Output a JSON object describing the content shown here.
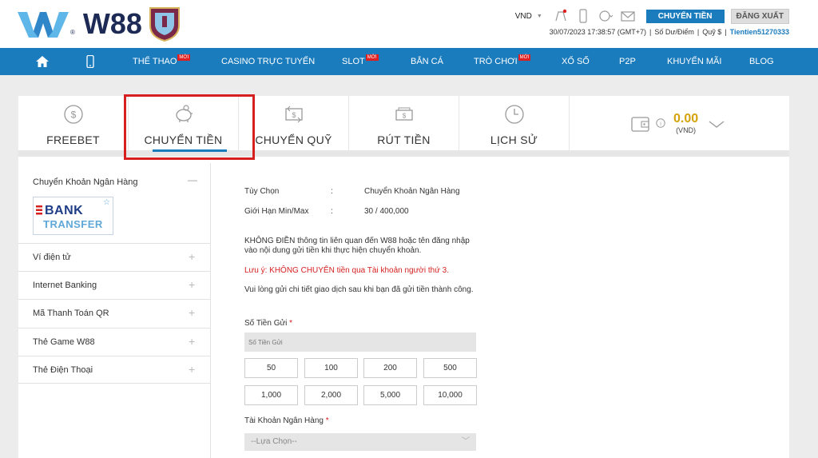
{
  "header": {
    "brand": "W88",
    "brand_dot": "®",
    "currency": "VND",
    "transfer_button": "CHUYỂN TIỀN",
    "logout_button": "ĐĂNG XUẤT",
    "datetime": "30/07/2023 17:38:57 (GMT+7)",
    "separator": "|",
    "balance_label": "Số Dư/Điểm",
    "fund_label": "Quỹ $",
    "username": "Tientien51270333"
  },
  "nav": {
    "badge": "MỚI",
    "items": [
      {
        "label": "THỂ THAO"
      },
      {
        "label": "CASINO TRỰC TUYẾN"
      },
      {
        "label": "SLOT"
      },
      {
        "label": "BẮN CÁ"
      },
      {
        "label": "TRÒ CHƠI"
      },
      {
        "label": "XỔ SỐ"
      },
      {
        "label": "P2P"
      },
      {
        "label": "KHUYẾN MÃI"
      },
      {
        "label": "BLOG"
      }
    ]
  },
  "tabs": [
    {
      "label": "FREEBET"
    },
    {
      "label": "CHUYỂN TIỀN"
    },
    {
      "label": "CHUYỂN QUỸ"
    },
    {
      "label": "RÚT TIỀN"
    },
    {
      "label": "LỊCH SỬ"
    }
  ],
  "wallet": {
    "amount": "0.00",
    "currency": "(VND)"
  },
  "sidebar": {
    "first": "Chuyển Khoản Ngân Hàng",
    "bank_logo_line1": "BANK",
    "bank_logo_line2": "TRANSFER",
    "items": [
      {
        "label": "Ví điện tử"
      },
      {
        "label": "Internet Banking"
      },
      {
        "label": "Mã Thanh Toán QR"
      },
      {
        "label": "Thẻ Game W88"
      },
      {
        "label": "Thẻ Điện Thoại"
      }
    ]
  },
  "form": {
    "option_label": "Tùy Chọn",
    "colon": ":",
    "option_value": "Chuyển Khoản Ngân Hàng",
    "limit_label": "Giới Hạn Min/Max",
    "limit_value": "30 / 400,000",
    "notice1": "KHÔNG ĐIỀN thông tin liên quan đến W88 hoặc tên đăng nhập vào nội dung gửi tiền khi thực hiện chuyển khoản.",
    "notice2": "Lưu ý: KHÔNG CHUYỂN tiền qua Tài khoản người thứ 3.",
    "notice3": "Vui lòng gửi chi tiết giao dịch sau khi bạn đã gửi tiền thành công.",
    "amount_label": "Số Tiền Gửi",
    "required": "*",
    "amount_placeholder": "Số Tiền Gửi",
    "quick_amounts": [
      "50",
      "100",
      "200",
      "500",
      "1,000",
      "2,000",
      "5,000",
      "10,000"
    ],
    "bank_account_label": "Tài Khoản Ngân Hàng",
    "bank_select": "--Lựa Chọn--"
  },
  "colors": {
    "primary": "#1a7bbd",
    "accent_red": "#d62020",
    "gold": "#d4a20a"
  }
}
